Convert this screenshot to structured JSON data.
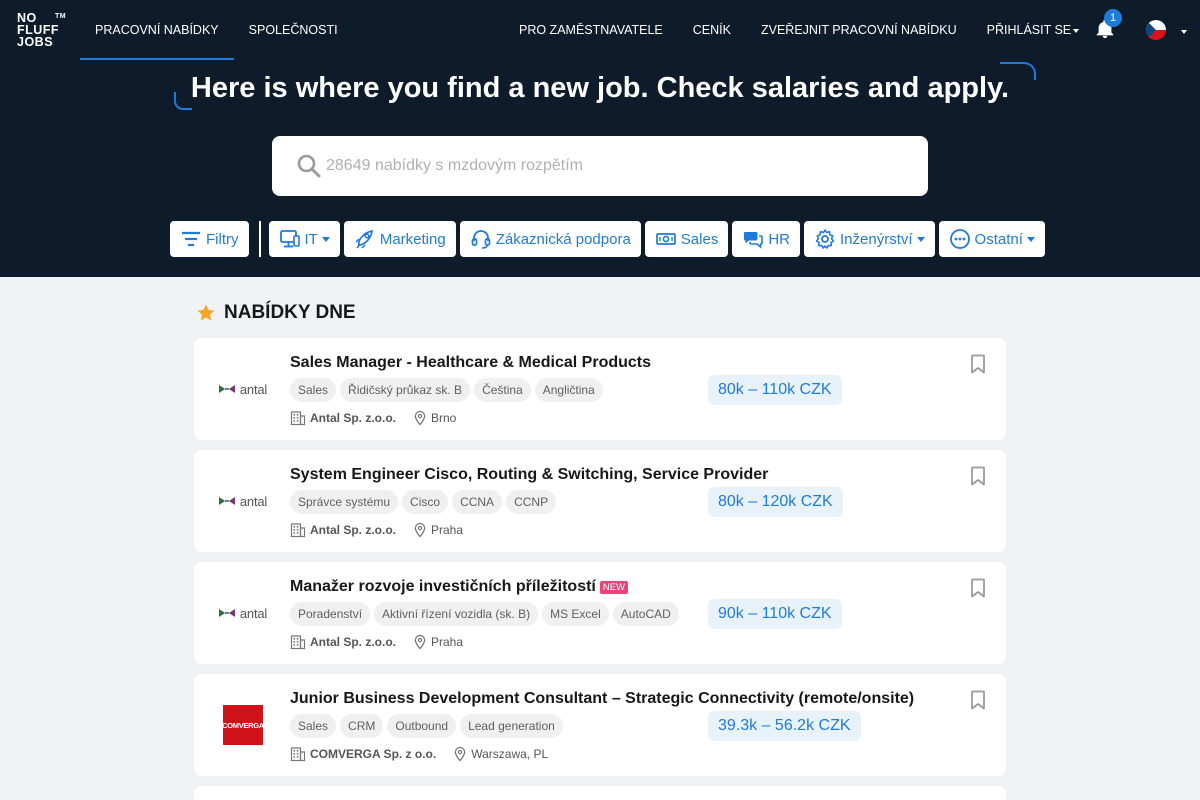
{
  "logo": {
    "line1": "NO",
    "line2": "FLUFF",
    "line3": "JOBS",
    "tm": "TM"
  },
  "nav": {
    "left": [
      {
        "label": "PRACOVNÍ NABÍDKY",
        "active": true
      },
      {
        "label": "SPOLEČNOSTI",
        "active": false
      }
    ],
    "right": [
      {
        "label": "PRO ZAMĚSTNAVATELE"
      },
      {
        "label": "CENÍK"
      },
      {
        "label": "ZVEŘEJNIT PRACOVNÍ NABÍDKU"
      },
      {
        "label": "PŘIHLÁSIT SE"
      }
    ],
    "notifications_count": "1",
    "language_icon": "czech-flag-icon"
  },
  "hero": {
    "headline_bold": "Here is where you find a new job.",
    "headline_rest": "Check salaries and apply."
  },
  "search": {
    "placeholder": "28649 nabídky s mzdovým rozpětím",
    "value": ""
  },
  "categories": {
    "filters": "Filtry",
    "items": [
      "IT",
      "Marketing",
      "Zákaznická podpora",
      "Sales",
      "HR",
      "Inženýrství",
      "Ostatní"
    ]
  },
  "section": {
    "title": "NABÍDKY DNE",
    "icon": "star-icon"
  },
  "jobs": [
    {
      "title": "Sales Manager - Healthcare & Medical Products",
      "new": "",
      "tags": [
        "Sales",
        "Řidičský průkaz sk. B",
        "Čeština",
        "Angličtina"
      ],
      "company": "Antal Sp. z.o.o.",
      "location": "Brno",
      "salary": "80k – 110k CZK",
      "logo_text": "antal"
    },
    {
      "title": "System Engineer Cisco, Routing & Switching, Service Provider",
      "new": "",
      "tags": [
        "Správce systému",
        "Cisco",
        "CCNA",
        "CCNP"
      ],
      "company": "Antal Sp. z.o.o.",
      "location": "Praha",
      "salary": "80k – 120k CZK",
      "logo_text": "antal"
    },
    {
      "title": "Manažer rozvoje investičních příležitostí",
      "new": "NEW",
      "tags": [
        "Poradenství",
        "Aktivní řízení vozidla (sk. B)",
        "MS Excel",
        "AutoCAD"
      ],
      "company": "Antal Sp. z.o.o.",
      "location": "Praha",
      "salary": "90k – 110k CZK",
      "logo_text": "antal"
    },
    {
      "title": "Junior Business Development Consultant – Strategic Connectivity (remote/onsite)",
      "new": "",
      "tags": [
        "Sales",
        "CRM",
        "Outbound",
        "Lead generation"
      ],
      "company": "COMVERGA Sp. z o.o.",
      "location": "Warszawa, PL",
      "salary": "39.3k – 56.2k CZK",
      "logo_text": "COMVERGA"
    }
  ],
  "colors": {
    "hero_bg": "#0d1b2a",
    "accent": "#1f7bd9",
    "page_bg": "#f0f2f5",
    "new_badge": "#e8457c",
    "salary_bg": "#e8f2fb"
  }
}
